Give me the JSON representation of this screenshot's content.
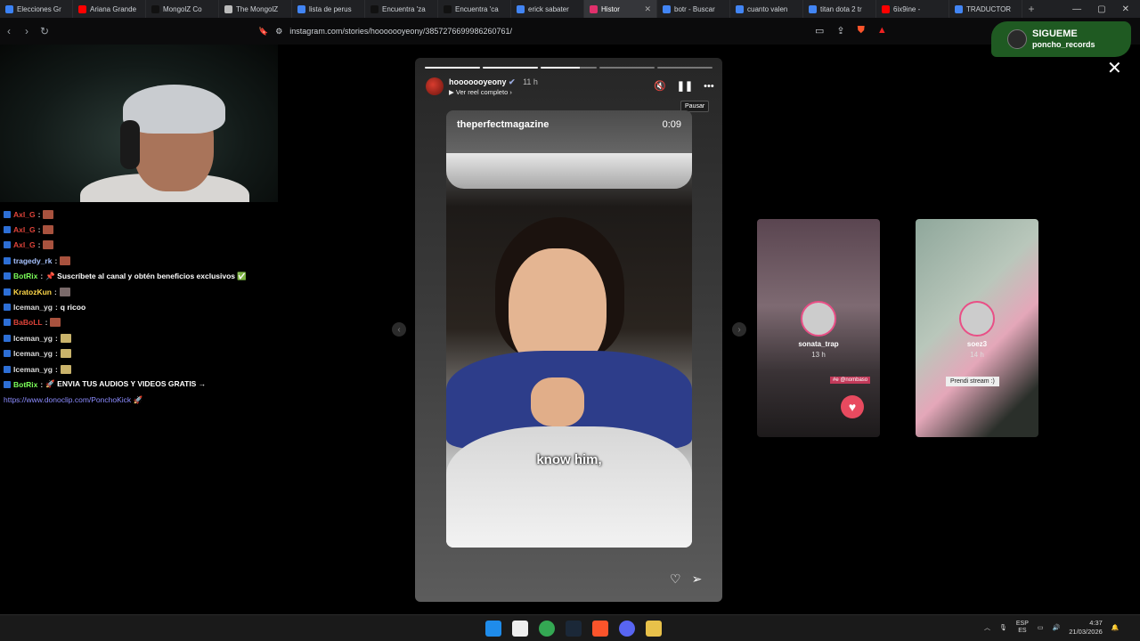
{
  "browser": {
    "tabs": [
      {
        "title": "Elecciones Gr",
        "color": "#3b82f6"
      },
      {
        "title": "Ariana Grande",
        "color": "#ff0000"
      },
      {
        "title": "MongolZ Co",
        "color": "#111111"
      },
      {
        "title": "The MongolZ",
        "color": "#bbbbbb"
      },
      {
        "title": "lista de perus",
        "color": "#4285f4"
      },
      {
        "title": "Encuentra 'za",
        "color": "#111111"
      },
      {
        "title": "Encuentra 'ca",
        "color": "#111111"
      },
      {
        "title": "erick sabater",
        "color": "#4285f4"
      },
      {
        "title": "Histor",
        "color": "#e1306c",
        "active": true
      },
      {
        "title": "botr - Buscar",
        "color": "#4285f4"
      },
      {
        "title": "cuanto valen",
        "color": "#4285f4"
      },
      {
        "title": "titan dota 2 tr",
        "color": "#4285f4"
      },
      {
        "title": "6ix9ine -",
        "color": "#ff0000"
      },
      {
        "title": "TRADUCTOR",
        "color": "#4285f4"
      }
    ],
    "url": "instagram.com/stories/hooooooyeony/3857276699986260761/"
  },
  "follow_banner": {
    "title": "SIGUEME",
    "handle": "poncho_records"
  },
  "chat": [
    {
      "user": "Axl_G",
      "color": "#e0443a",
      "text": "",
      "emote": "#a8523e"
    },
    {
      "user": "Axl_G",
      "color": "#e0443a",
      "text": "",
      "emote": "#a8523e"
    },
    {
      "user": "Axl_G",
      "color": "#e0443a",
      "text": "",
      "emote": "#a8523e"
    },
    {
      "user": "tragedy_rk",
      "color": "#a8c3ff",
      "text": "",
      "emote": "#a8523e"
    },
    {
      "user": "BotRix",
      "color": "#7cff5a",
      "text": "📌 Suscríbete al canal y obtén beneficios exclusivos ✅",
      "emote": ""
    },
    {
      "user": "KratozKun",
      "color": "#ffd84a",
      "text": "",
      "emote": "#7a6a6a"
    },
    {
      "user": "Iceman_yg",
      "color": "#dddddd",
      "text": "q ricoo",
      "emote": ""
    },
    {
      "user": "BaBoLL",
      "color": "#e0443a",
      "text": "",
      "emote": "#a8523e"
    },
    {
      "user": "Iceman_yg",
      "color": "#dddddd",
      "text": "",
      "emote": "#c9b36b"
    },
    {
      "user": "Iceman_yg",
      "color": "#dddddd",
      "text": "",
      "emote": "#c9b36b"
    },
    {
      "user": "Iceman_yg",
      "color": "#dddddd",
      "text": "",
      "emote": "#c9b36b"
    },
    {
      "user": "BotRix",
      "color": "#7cff5a",
      "text": "🚀 ENVIA TUS AUDIOS Y VIDEOS GRATIS →",
      "emote": ""
    }
  ],
  "chat_link": "https://www.donoclip.com/PonchoKick 🚀",
  "story": {
    "username": "hooooooyeony",
    "time": "11 h",
    "reel_label": "Ver reel completo",
    "tooltip": "Pausar",
    "magazine": "theperfectmagazine",
    "duration": "0:09",
    "caption": "know him,"
  },
  "side_stories": [
    {
      "name": "sonata_trap",
      "time": "13 h",
      "tag": "#e @nombaso"
    },
    {
      "name": "soez3",
      "time": "14 h",
      "tag": "Prendi stream :)"
    }
  ],
  "taskbar": {
    "lang1": "ESP",
    "lang2": "ES",
    "time": "4:37",
    "date": "21/03/2026"
  }
}
